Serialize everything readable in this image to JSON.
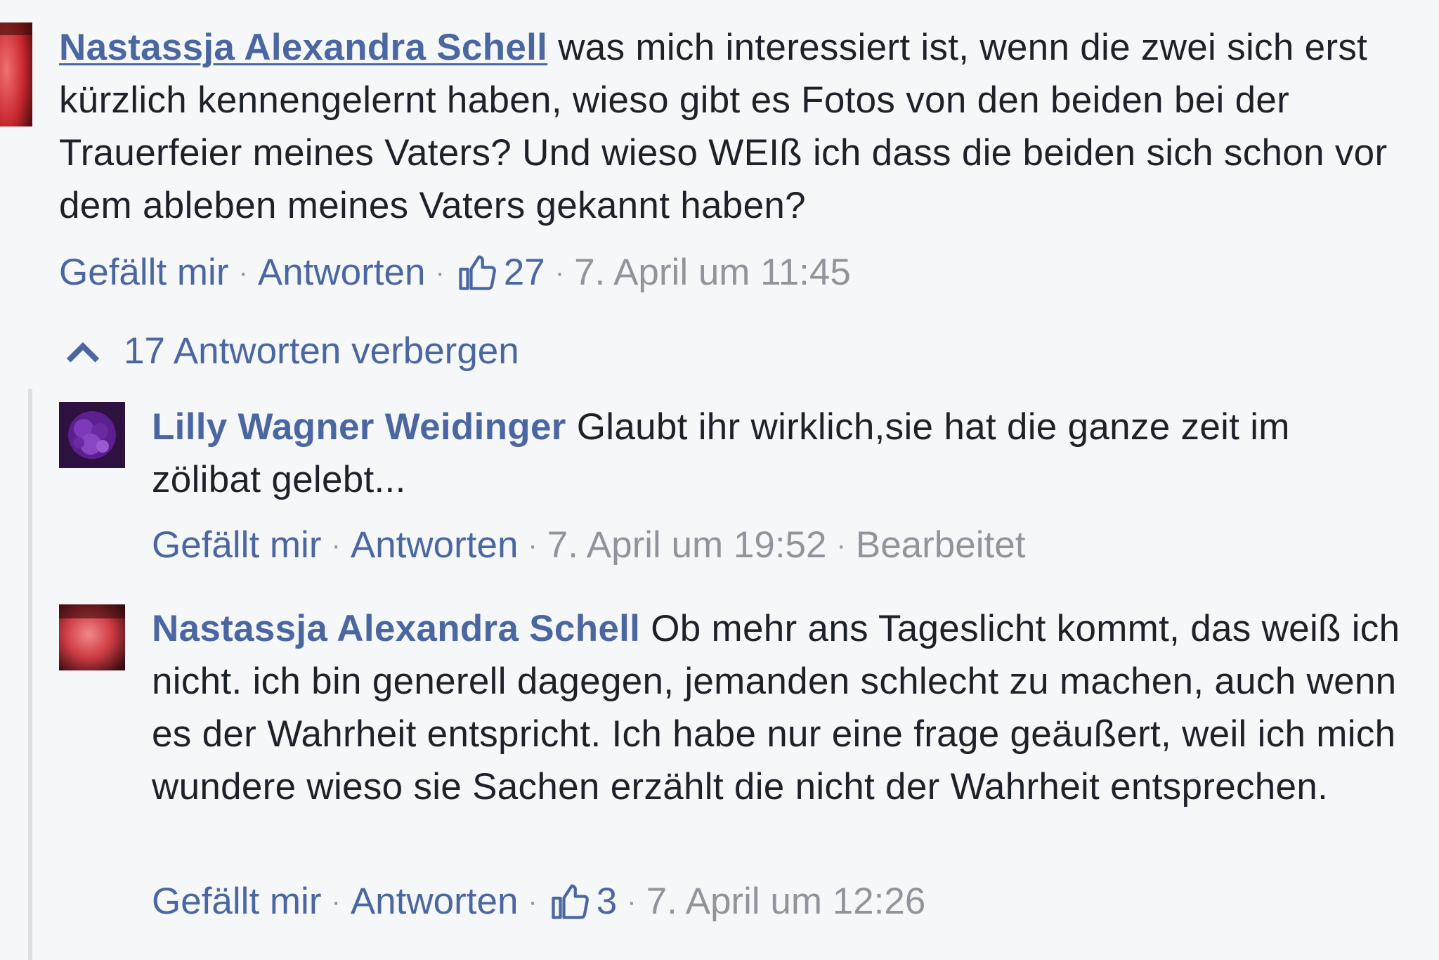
{
  "thread": {
    "main_comment": {
      "author": "Nastassja Alexandra Schell",
      "text": "was mich interessiert ist, wenn die zwei sich erst kürzlich kennengelernt haben, wieso gibt es Fotos von den beiden bei der Trauerfeier meines Vaters? Und wieso WEIß ich dass die beiden sich schon vor dem ableben meines Vaters gekannt haben?",
      "like_label": "Gefällt mir",
      "reply_label": "Antworten",
      "like_count": "27",
      "timestamp": "7. April um 11:45"
    },
    "replies_toggle": {
      "label": "17 Antworten verbergen"
    },
    "replies": [
      {
        "author": "Lilly Wagner Weidinger",
        "text": "Glaubt ihr wirklich,sie hat die ganze zeit im zölibat gelebt...",
        "like_label": "Gefällt mir",
        "reply_label": "Antworten",
        "timestamp": "7. April um 19:52",
        "edited_label": "Bearbeitet"
      },
      {
        "author": "Nastassja Alexandra Schell",
        "text": "Ob mehr ans Tageslicht kommt, das weiß ich nicht. ich bin generell dagegen, jemanden schlecht zu machen, auch wenn es der Wahrheit entspricht. Ich habe nur eine frage geäußert, weil ich mich wundere wieso sie Sachen erzählt die nicht der Wahrheit entsprechen.",
        "like_label": "Gefällt mir",
        "reply_label": "Antworten",
        "like_count": "3",
        "timestamp": "7. April um 12:26"
      }
    ]
  },
  "colors": {
    "background": "#f6f7f9",
    "author_link": "#4b67a1",
    "meta_gray": "#90949c",
    "text": "#1d2129",
    "rail": "#dddfe2"
  },
  "icons": {
    "like": "thumbs-up-icon",
    "collapse": "chevron-up-icon"
  }
}
